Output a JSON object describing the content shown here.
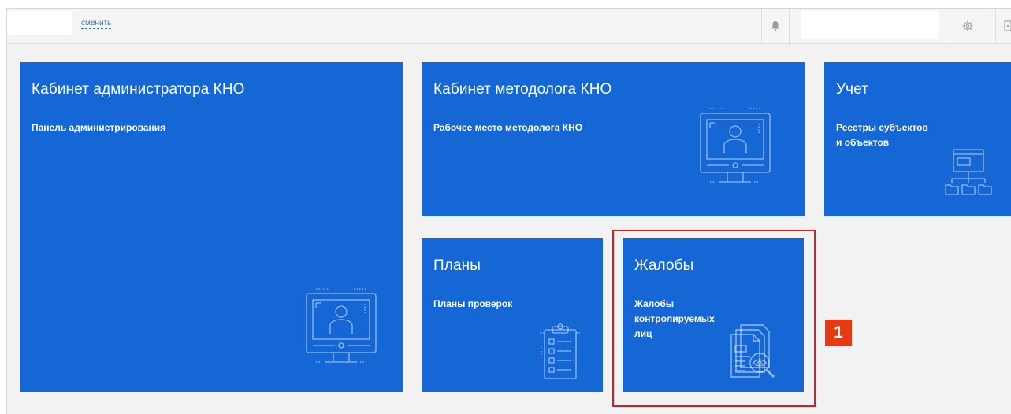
{
  "header": {
    "change_link": "сменить",
    "bell_icon": "bell-icon",
    "gear_icon": "gear-icon",
    "exit_icon": "exit-icon"
  },
  "tiles": [
    {
      "title": "Кабинет администратора КНО",
      "subtitle": "Панель администрирования",
      "icon": "monitor-user-icon"
    },
    {
      "title": "Кабинет методолога КНО",
      "subtitle": "Рабочее место методолога КНО",
      "icon": "monitor-user-icon"
    },
    {
      "title": "Учет",
      "subtitle_lines": [
        "Реестры субъектов",
        "и объектов"
      ],
      "icon": "registry-folders-icon"
    },
    {
      "title": "Планы",
      "subtitle": "Планы проверок",
      "icon": "clipboard-checklist-icon"
    },
    {
      "title": "Жалобы",
      "subtitle_lines": [
        "Жалобы",
        "контролируемых",
        "лиц"
      ],
      "icon": "document-search-icon"
    }
  ],
  "annotation": {
    "marker": "1",
    "highlight_color": "#e0191c",
    "marker_color": "#e53a12"
  },
  "colors": {
    "tile": "#1467d4",
    "background": "#f2f2f2",
    "link": "#2a7bd6"
  }
}
